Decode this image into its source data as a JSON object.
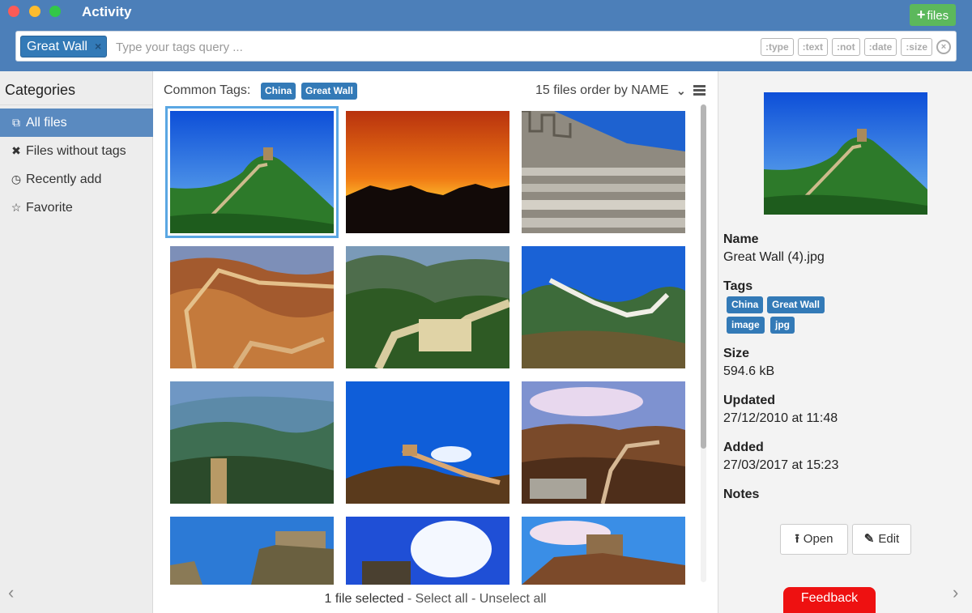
{
  "window": {
    "title": "Activity",
    "add_files_label": "files",
    "add_files_icon": "plus-icon"
  },
  "search": {
    "active_tag": "Great Wall",
    "remove_icon": "×",
    "placeholder": "Type your tags query ...",
    "filters": [
      ":type",
      ":text",
      ":not",
      ":date",
      ":size"
    ],
    "clear_icon": "×"
  },
  "sidebar": {
    "title": "Categories",
    "items": [
      {
        "label": "All files",
        "icon": "copy-icon",
        "glyph": "⧉"
      },
      {
        "label": "Files without tags",
        "icon": "times-icon",
        "glyph": "✖"
      },
      {
        "label": "Recently add",
        "icon": "clock-icon",
        "glyph": "◷"
      },
      {
        "label": "Favorite",
        "icon": "star-icon",
        "glyph": "☆"
      }
    ],
    "nav_left": "‹"
  },
  "main": {
    "common_tags_label": "Common Tags:",
    "common_tags": [
      "China",
      "Great Wall"
    ],
    "sort_text": "15 files order by NAME",
    "sort_chevron": "⌄",
    "status_selected": "1 file selected",
    "status_sep1": " - ",
    "select_all": "Select all",
    "status_sep2": " - ",
    "unselect_all": "Unselect all"
  },
  "details": {
    "name_label": "Name",
    "name_value": "Great Wall (4).jpg",
    "tags_label": "Tags",
    "tags": [
      "China",
      "Great Wall",
      "image",
      "jpg"
    ],
    "size_label": "Size",
    "size_value": "594.6 kB",
    "updated_label": "Updated",
    "updated_value": "27/12/2010 at 11:48",
    "added_label": "Added",
    "added_value": "27/03/2017 at 15:23",
    "notes_label": "Notes",
    "open_label": "Open",
    "open_icon": "⭱",
    "edit_label": "Edit",
    "edit_icon": "✎",
    "feedback_label": "Feedback",
    "nav_right": "›"
  },
  "colors": {
    "titlebar": "#4c7fb9",
    "accent": "#337ab7",
    "add_button": "#5cb85c",
    "feedback": "#ee1111",
    "selection_outline": "#5aa7e3"
  }
}
